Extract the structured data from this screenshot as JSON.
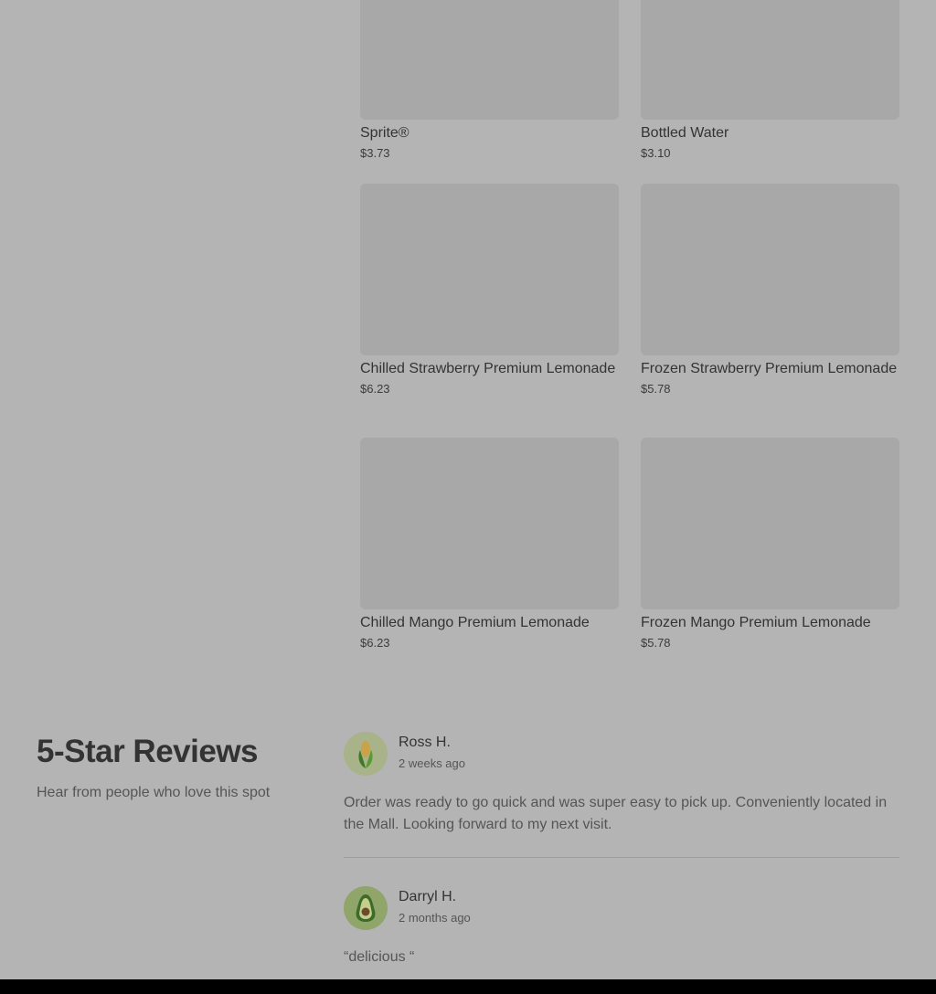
{
  "menu": {
    "items": [
      {
        "name": "Sprite®",
        "price": "$3.73"
      },
      {
        "name": "Bottled Water",
        "price": "$3.10"
      },
      {
        "name": "Chilled Strawberry Premium Lemonade",
        "price": "$6.23"
      },
      {
        "name": "Frozen Strawberry Premium Lemonade",
        "price": "$5.78"
      },
      {
        "name": "Chilled Mango Premium Lemonade",
        "price": "$6.23"
      },
      {
        "name": "Frozen Mango Premium Lemonade",
        "price": "$5.78"
      }
    ]
  },
  "reviews_section": {
    "title": "5-Star Reviews",
    "subtitle": "Hear from people who love this spot",
    "reviews": [
      {
        "author": "Ross H.",
        "time": "2 weeks ago",
        "text": "Order was ready to go quick and was super easy to pick up. Conveniently located in the Mall. Looking forward to my next visit.",
        "avatar_icon": "corn-icon"
      },
      {
        "author": "Darryl H.",
        "time": "2 months ago",
        "text": "“delicious “",
        "avatar_icon": "avocado-icon"
      }
    ]
  },
  "colors": {
    "overlay_background": "#b4b4b4",
    "image_placeholder": "#a8a8a8",
    "avatar_corn_bg": "#a9b38a",
    "avatar_avocado_bg": "#8fa56a"
  }
}
